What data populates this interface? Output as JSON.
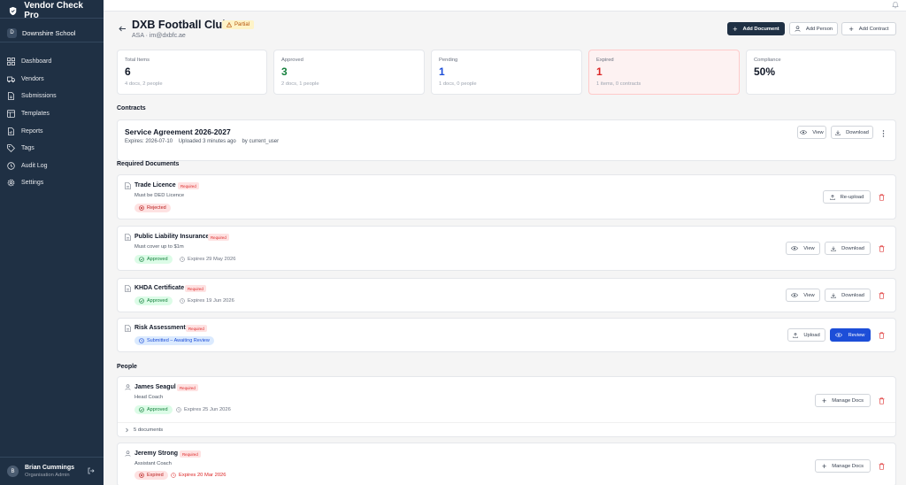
{
  "app": {
    "name": "Vendor Check Pro"
  },
  "sidebar": {
    "school_initial": "D",
    "school_name": "Downshire School",
    "items": [
      {
        "label": "Dashboard",
        "icon": "grid-icon"
      },
      {
        "label": "Vendors",
        "icon": "truck-icon"
      },
      {
        "label": "Submissions",
        "icon": "document-icon"
      },
      {
        "label": "Templates",
        "icon": "template-icon"
      },
      {
        "label": "Reports",
        "icon": "chart-icon"
      },
      {
        "label": "Tags",
        "icon": "tag-icon"
      },
      {
        "label": "Audit Log",
        "icon": "clock-icon"
      },
      {
        "label": "Settings",
        "icon": "gear-icon"
      }
    ],
    "user": {
      "initial": "B",
      "name": "Brian Cummings",
      "role": "Organisation Admin"
    }
  },
  "header": {
    "title": "DXB Football Club",
    "badge": "Partial",
    "subtitle": "ASA · im@dxbfc.ae",
    "add_document": "Add Document",
    "add_person": "Add Person",
    "add_contract": "Add Contract"
  },
  "stats": [
    {
      "label": "Total Items",
      "value": "6",
      "sub": "4 docs, 2 people",
      "color": "#111827"
    },
    {
      "label": "Approved",
      "value": "3",
      "sub": "2 docs, 1 people",
      "color": "#15803d"
    },
    {
      "label": "Pending",
      "value": "1",
      "sub": "1 docs, 0 people",
      "color": "#1d4ed8"
    },
    {
      "label": "Expired",
      "value": "1",
      "sub": "1 items, 0 contracts",
      "color": "#dc2626"
    },
    {
      "label": "Compliance",
      "value": "50%",
      "sub": "",
      "color": "#111827"
    }
  ],
  "contracts": {
    "heading": "Contracts",
    "items": [
      {
        "title": "Service Agreement 2026-2027",
        "expires": "Expires: 2026-07-10",
        "uploaded": "Uploaded 3 minutes ago",
        "by": "by current_user",
        "view": "View",
        "download": "Download"
      }
    ]
  },
  "required_docs": {
    "heading": "Required Documents",
    "items": [
      {
        "title": "Trade Licence",
        "badge": "Required",
        "desc": "Must be DED Licence",
        "status": "Rejected",
        "expiry": "",
        "actions": [
          "Re-upload"
        ]
      },
      {
        "title": "Public Liability Insurance",
        "badge": "Required",
        "desc": "Must cover up to $1m",
        "status": "Approved",
        "expiry": "Expires 29 May 2026",
        "actions": [
          "View",
          "Download"
        ]
      },
      {
        "title": "KHDA Certificate",
        "badge": "Required",
        "desc": "",
        "status": "Approved",
        "expiry": "Expires 19 Jun 2026",
        "actions": [
          "View",
          "Download"
        ]
      },
      {
        "title": "Risk Assessment",
        "badge": "Required",
        "desc": "",
        "status": "Submitted – Awaiting Review",
        "expiry": "",
        "actions": [
          "Upload",
          "Review"
        ]
      }
    ]
  },
  "people": {
    "heading": "People",
    "items": [
      {
        "name": "James Seagul",
        "badge": "Required",
        "role": "Head Coach",
        "status": "Approved",
        "expiry": "Expires 25 Jun 2026",
        "action": "Manage Docs",
        "docs_toggle": "5 documents"
      },
      {
        "name": "Jeremy Strong",
        "badge": "Required",
        "role": "Assistant Coach",
        "status": "Expired",
        "expiry": "Expires 20 Mar 2026",
        "action": "Manage Docs"
      }
    ]
  },
  "colors": {
    "sidebar": "#1f3044",
    "primary_button": "#1f3044",
    "review_button": "#1d4ed8",
    "expired_card": "#fdf2f2"
  }
}
